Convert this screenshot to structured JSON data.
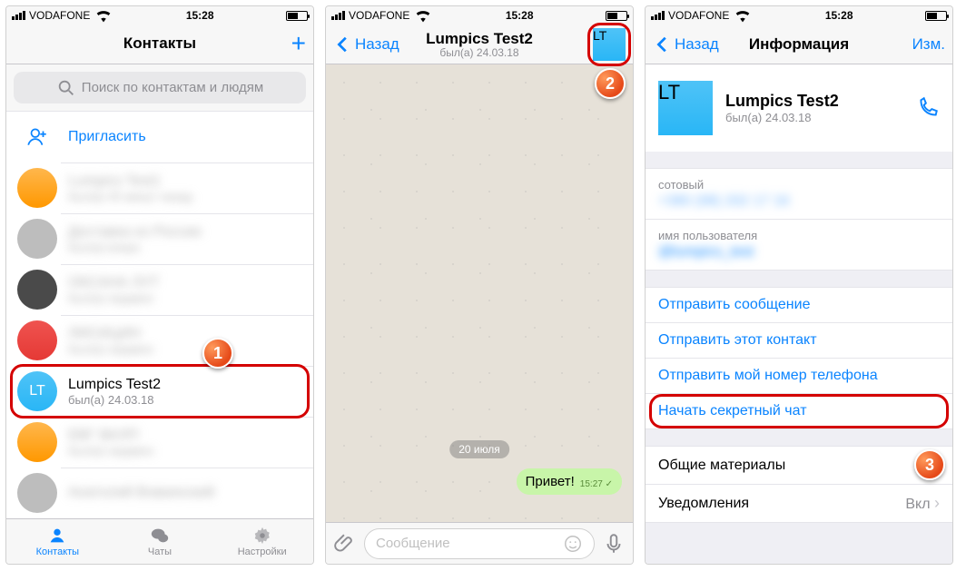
{
  "status": {
    "carrier": "VODAFONE",
    "time": "15:28"
  },
  "screen1": {
    "title": "Контакты",
    "search_placeholder": "Поиск по контактам и людям",
    "invite": "Пригласить",
    "contacts": [
      {
        "name": "Lumpics Test1",
        "sub": "был(а) 45 минут назад"
      },
      {
        "name": "Доставка из России",
        "sub": "был(а) вчера"
      },
      {
        "name": "ОКСАНА ЛУТ",
        "sub": "был(а) недавно"
      },
      {
        "name": "ЛИСИЦИН",
        "sub": "был(а) недавно"
      }
    ],
    "target": {
      "initials": "LT",
      "name": "Lumpics Test2",
      "sub": "был(а) 24.03.18"
    },
    "tabs": {
      "contacts": "Контакты",
      "chats": "Чаты",
      "settings": "Настройки"
    }
  },
  "screen2": {
    "back": "Назад",
    "title": "Lumpics Test2",
    "subtitle": "был(а) 24.03.18",
    "avatar_initials": "LT",
    "date_chip": "20 июля",
    "message": "Привет!",
    "message_time": "15:27",
    "input_placeholder": "Сообщение"
  },
  "screen3": {
    "back": "Назад",
    "title": "Информация",
    "edit": "Изм.",
    "avatar_initials": "LT",
    "name": "Lumpics Test2",
    "sub": "был(а) 24.03.18",
    "phone_label": "сотовый",
    "phone_value": "+380 (98) 202 17 16",
    "username_label": "имя пользователя",
    "username_value": "@lumpics_test",
    "send_message": "Отправить сообщение",
    "send_contact": "Отправить этот контакт",
    "send_my_number": "Отправить мой номер телефона",
    "start_secret_chat": "Начать секретный чат",
    "shared_media": "Общие материалы",
    "notifications": "Уведомления",
    "notifications_value": "Вкл"
  },
  "markers": {
    "m1": "1",
    "m2": "2",
    "m3": "3"
  }
}
